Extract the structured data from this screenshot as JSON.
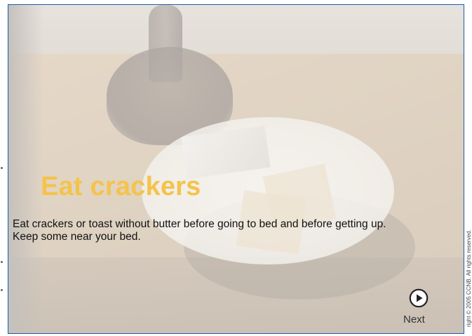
{
  "slide": {
    "title": "Eat crackers",
    "body": "Eat crackers or toast without butter before going to bed and before getting up. Keep some near your bed.",
    "next_label": "Next",
    "copyright": "right © 2005 CCNB. All rights reserved."
  },
  "colors": {
    "title": "#f4c34a",
    "frame_border": "#1a5ea8",
    "body_text": "#111111"
  },
  "icons": {
    "next": "play-circle-icon"
  },
  "background_image": "washed-out photo of a plate with crackers and a cracker packet on a wooden nightstand beside a lamp base"
}
